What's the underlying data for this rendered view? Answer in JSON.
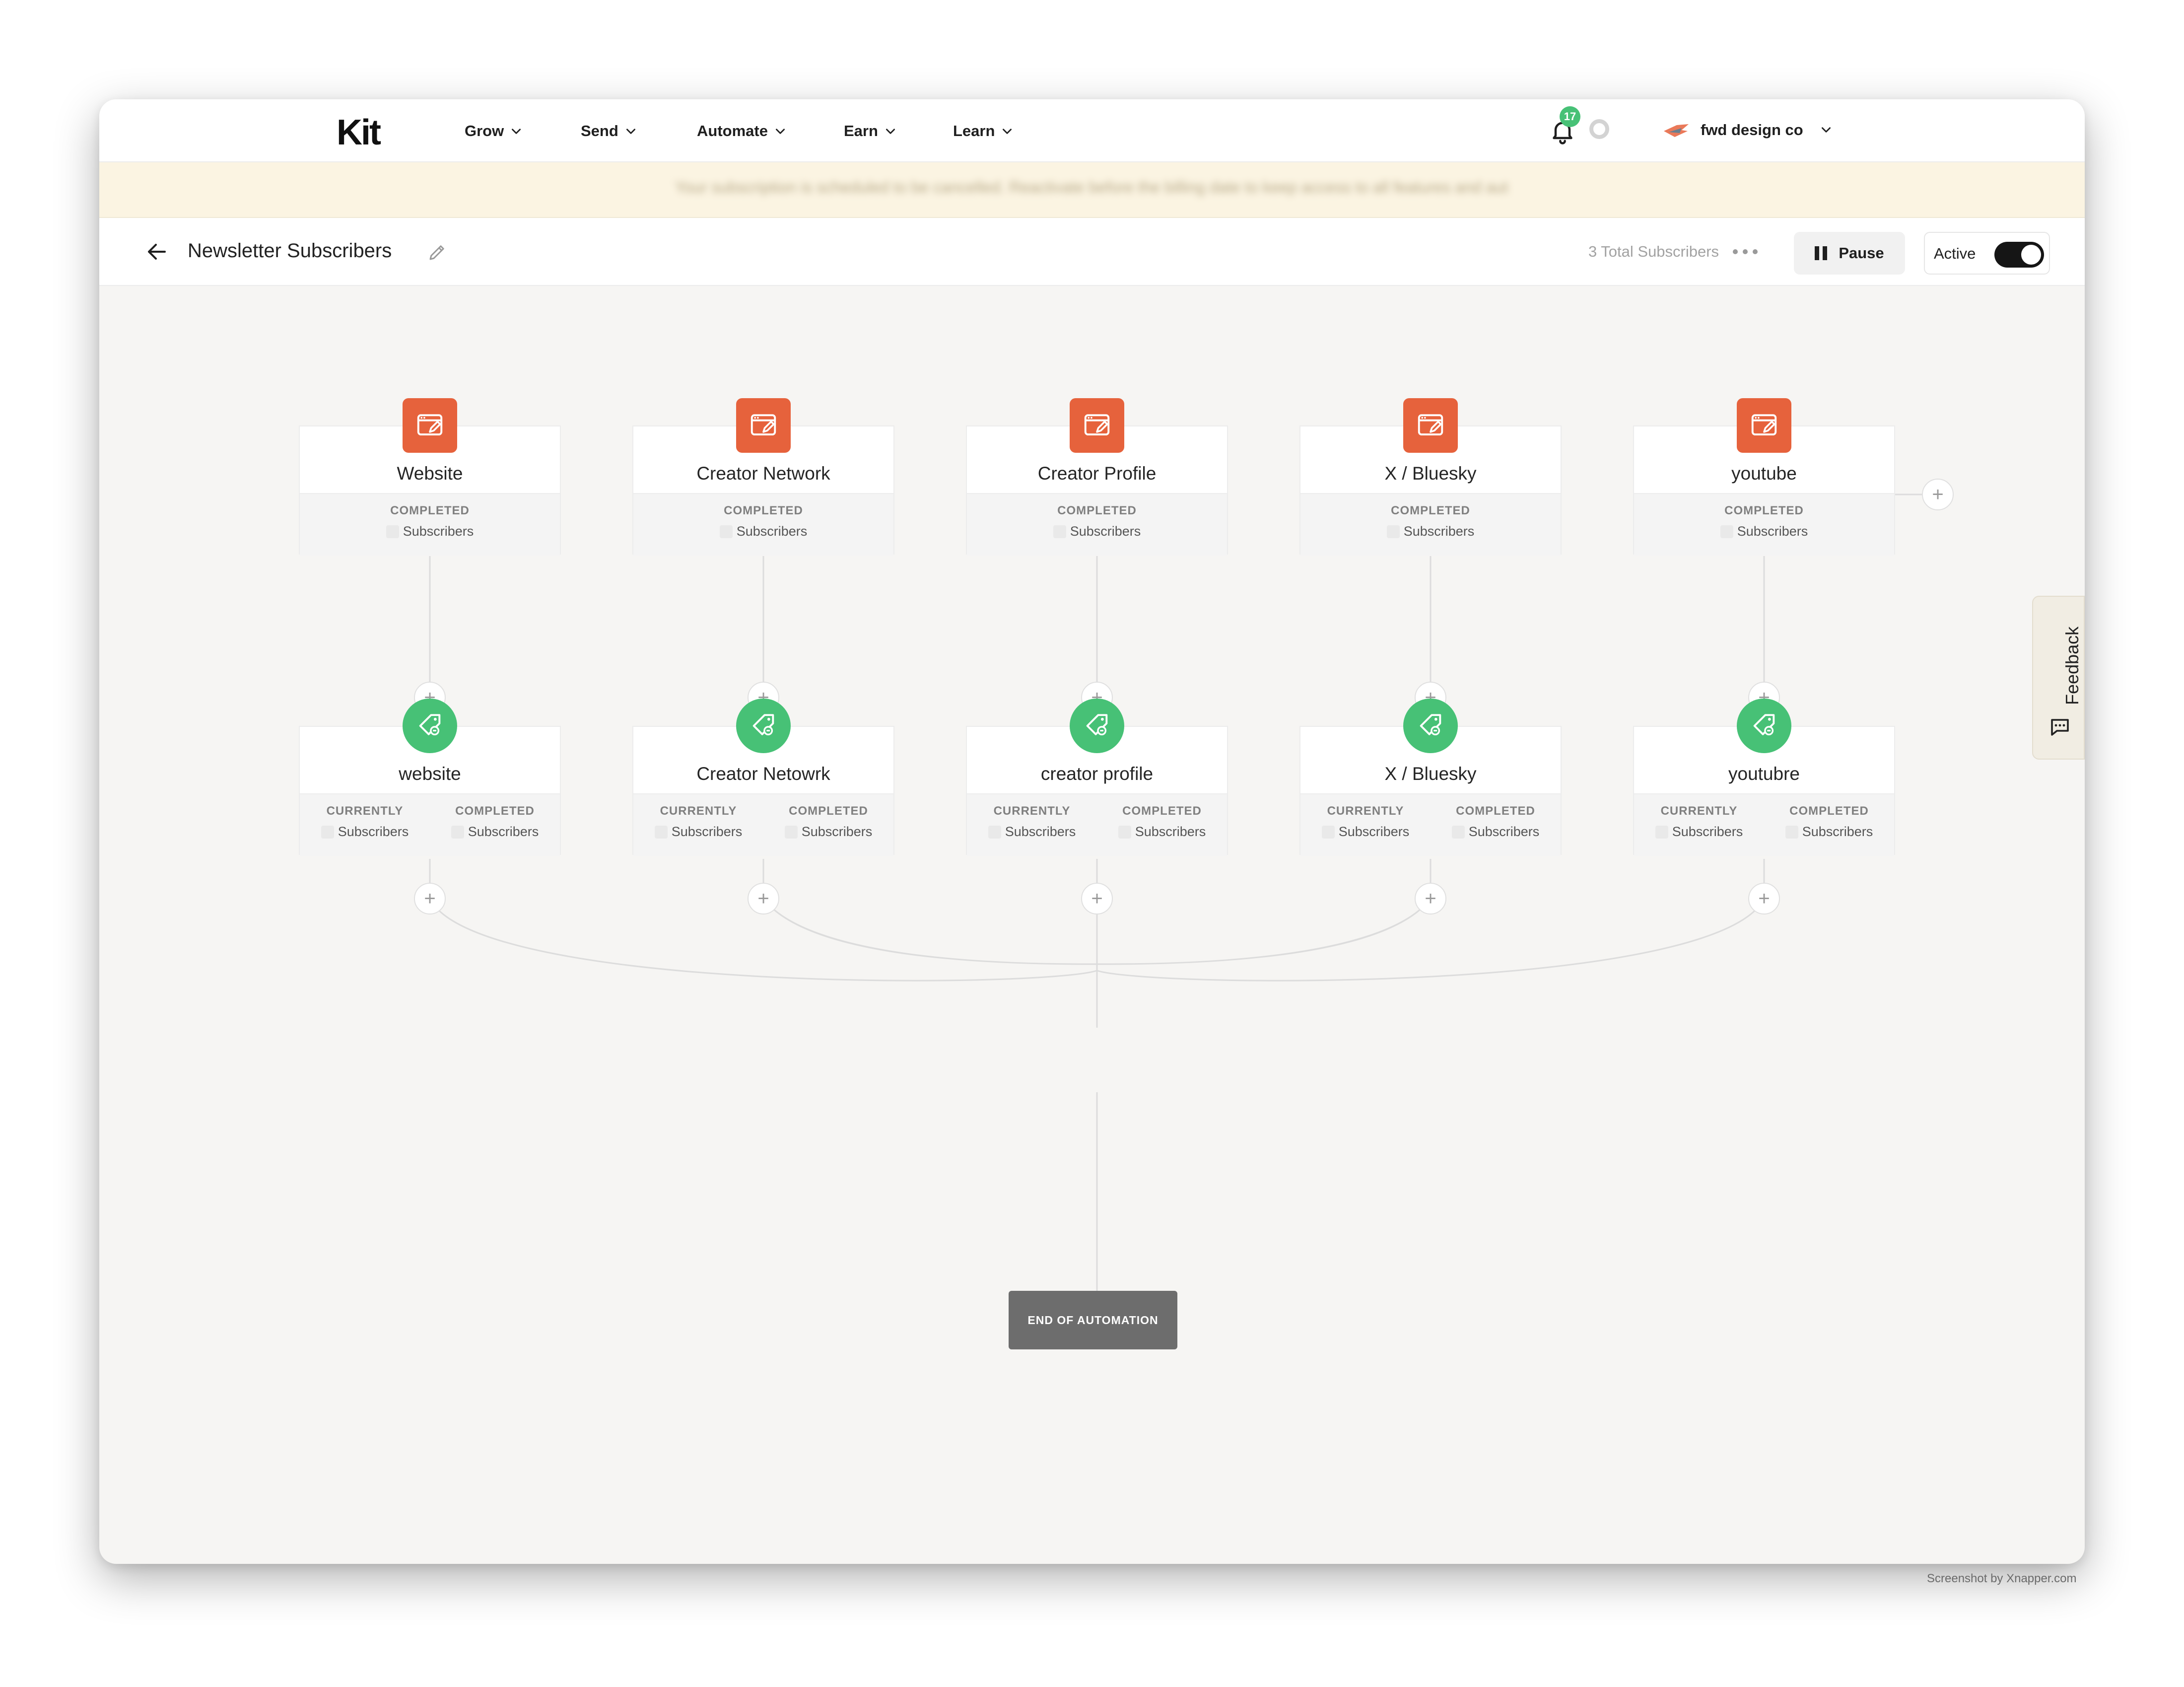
{
  "app": {
    "logo": "Kit"
  },
  "nav": {
    "items": [
      {
        "label": "Grow"
      },
      {
        "label": "Send"
      },
      {
        "label": "Automate"
      },
      {
        "label": "Earn"
      },
      {
        "label": "Learn"
      }
    ],
    "notifications_count": "17",
    "account_name": "fwd design co"
  },
  "notice": {
    "text": "Your subscription is scheduled to be cancelled. Reactivate before the billing date to keep access to all features and automations."
  },
  "header": {
    "title": "Newsletter Subscribers",
    "total_subscribers": "3 Total Subscribers",
    "pause_label": "Pause",
    "active_label": "Active",
    "active_on": true
  },
  "triggers": [
    {
      "title": "Website",
      "status_label": "COMPLETED",
      "unit": "Subscribers"
    },
    {
      "title": "Creator Network",
      "status_label": "COMPLETED",
      "unit": "Subscribers"
    },
    {
      "title": "Creator Profile",
      "status_label": "COMPLETED",
      "unit": "Subscribers"
    },
    {
      "title": "X / Bluesky",
      "status_label": "COMPLETED",
      "unit": "Subscribers"
    },
    {
      "title": "youtube",
      "status_label": "COMPLETED",
      "unit": "Subscribers"
    }
  ],
  "actions": [
    {
      "title": "website",
      "current_label": "CURRENTLY",
      "completed_label": "COMPLETED",
      "unit": "Subscribers"
    },
    {
      "title": "Creator Netowrk",
      "current_label": "CURRENTLY",
      "completed_label": "COMPLETED",
      "unit": "Subscribers"
    },
    {
      "title": "creator profile",
      "current_label": "CURRENTLY",
      "completed_label": "COMPLETED",
      "unit": "Subscribers"
    },
    {
      "title": "X / Bluesky",
      "current_label": "CURRENTLY",
      "completed_label": "COMPLETED",
      "unit": "Subscribers"
    },
    {
      "title": "youtubre",
      "current_label": "CURRENTLY",
      "completed_label": "COMPLETED",
      "unit": "Subscribers"
    }
  ],
  "add_symbol": "+",
  "end_label": "END OF AUTOMATION",
  "feedback_label": "Feedback",
  "credit": "Screenshot by Xnapper.com",
  "colors": {
    "trigger": "#e6623c",
    "action": "#47c176",
    "end": "#6d6d6d",
    "accent_badge": "#47c176"
  },
  "icons": {
    "trigger": "form-icon",
    "action": "tag-icon",
    "notification": "bell-icon",
    "feedback": "chat-bubble-icon"
  }
}
